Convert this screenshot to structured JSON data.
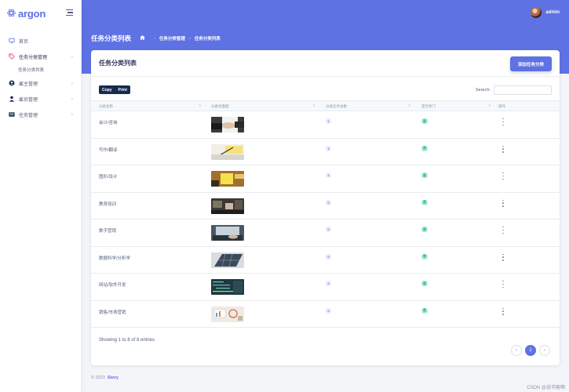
{
  "app": {
    "brand": "argon"
  },
  "user": {
    "name": "admin"
  },
  "sidebar": {
    "items": [
      {
        "label": "首页",
        "icon": "monitor-icon"
      },
      {
        "label": "任务分类管理",
        "icon": "tag-icon",
        "sub": "任务分类列表"
      },
      {
        "label": "雇主管理",
        "icon": "user-circle-icon"
      },
      {
        "label": "雇员管理",
        "icon": "user-icon"
      },
      {
        "label": "任务管理",
        "icon": "list-icon"
      }
    ]
  },
  "header": {
    "title": "任务分类列表",
    "breadcrumb": [
      "任务分类管理",
      "任务分类列表"
    ]
  },
  "card": {
    "title": "任务分类列表",
    "add_button": "添加任务分类",
    "copy_button": "Copy",
    "print_button": "Print",
    "search_label": "Search:",
    "search_value": ""
  },
  "table": {
    "columns": [
      "分类名称",
      "分类封面图",
      "分类任务总数",
      "是否热门",
      "操作"
    ],
    "rows": [
      {
        "name": "会计/咨询",
        "count": "1",
        "hot": "是",
        "thumb": "handshake-photo"
      },
      {
        "name": "写作/翻译",
        "count": "1",
        "hot": "是",
        "thumb": "writing-photo"
      },
      {
        "name": "图形/设计",
        "count": "1",
        "hot": "是",
        "thumb": "sticky-notes-photo"
      },
      {
        "name": "教育培训",
        "count": "0",
        "hot": "是",
        "thumb": "classroom-photo"
      },
      {
        "name": "数字营销",
        "count": "0",
        "hot": "是",
        "thumb": "laptop-typing-photo"
      },
      {
        "name": "数据科学/分析学",
        "count": "0",
        "hot": "是",
        "thumb": "solar-panel-photo"
      },
      {
        "name": "网站/软件开发",
        "count": "2",
        "hot": "是",
        "thumb": "code-screen-photo"
      },
      {
        "name": "销售/市场营销",
        "count": "0",
        "hot": "是",
        "thumb": "desk-charts-photo"
      }
    ],
    "info": "Showing 1 to 8 of 8 entries"
  },
  "pagination": {
    "prev": "‹",
    "current": "1",
    "next": "›"
  },
  "footer": {
    "copyright": "© 2023",
    "link": "Story"
  },
  "watermark": "CSDN @说书客啊",
  "colors": {
    "primary": "#5e72e4",
    "dark": "#172b4d",
    "success": "#2dce89"
  }
}
